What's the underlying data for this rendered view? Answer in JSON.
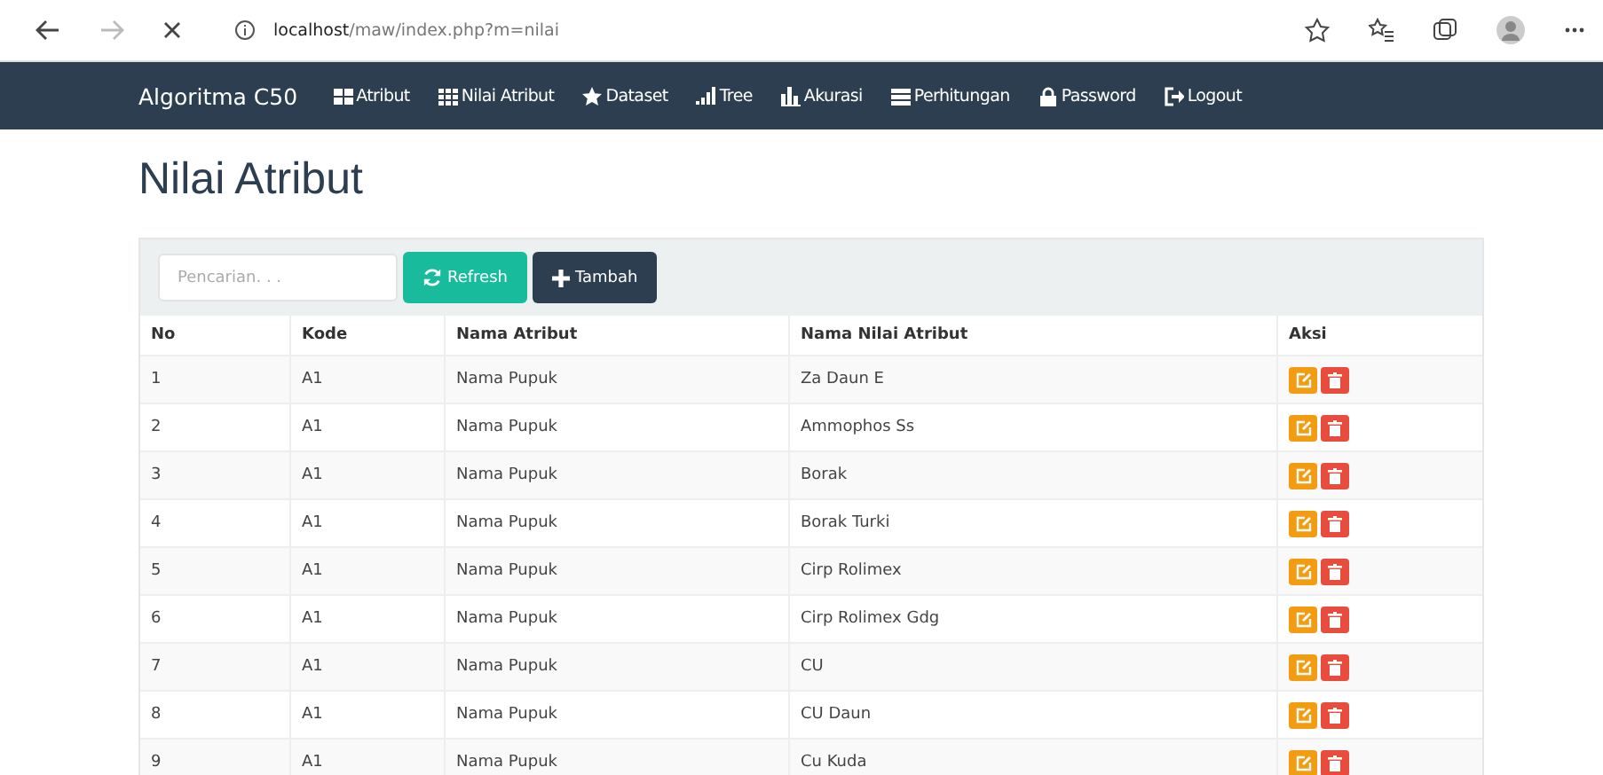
{
  "browser": {
    "url": "**localhost**/maw/index.php?m=nilai"
  },
  "navbar": {
    "brand": "Algoritma C50",
    "items": [
      {
        "label": "Atribut",
        "kind": "grid4"
      },
      {
        "label": "Nilai Atribut",
        "kind": "grid9"
      },
      {
        "label": "Dataset",
        "kind": "star"
      },
      {
        "label": "Tree",
        "kind": "signal"
      },
      {
        "label": "Akurasi",
        "kind": "bars"
      },
      {
        "label": "Perhitungan",
        "kind": "table"
      },
      {
        "label": "Password",
        "kind": "lock"
      },
      {
        "label": "Logout",
        "kind": "logout"
      }
    ]
  },
  "page_title": "Nilai Atribut",
  "toolbar": {
    "search": {
      "placeholder": "Pencarian. . ."
    },
    "buttons": [
      {
        "label": "Refresh",
        "kind": "refresh"
      },
      {
        "label": "Tambah",
        "kind": "add"
      }
    ]
  },
  "table": {
    "columns": [
      "No",
      "Kode",
      "Nama Atribut",
      "Nama Nilai Atribut",
      "Aksi"
    ],
    "rows": [
      [
        "1",
        "A1",
        "Nama Pupuk",
        "Za Daun E"
      ],
      [
        "2",
        "A1",
        "Nama Pupuk",
        "Ammophos Ss"
      ],
      [
        "3",
        "A1",
        "Nama Pupuk",
        "Borak"
      ],
      [
        "4",
        "A1",
        "Nama Pupuk",
        "Borak Turki"
      ],
      [
        "5",
        "A1",
        "Nama Pupuk",
        "Cirp Rolimex"
      ],
      [
        "6",
        "A1",
        "Nama Pupuk",
        "Cirp Rolimex Gdg"
      ],
      [
        "7",
        "A1",
        "Nama Pupuk",
        "CU"
      ],
      [
        "8",
        "A1",
        "Nama Pupuk",
        "CU Daun"
      ],
      [
        "9",
        "A1",
        "Nama Pupuk",
        "Cu Kuda"
      ]
    ]
  }
}
